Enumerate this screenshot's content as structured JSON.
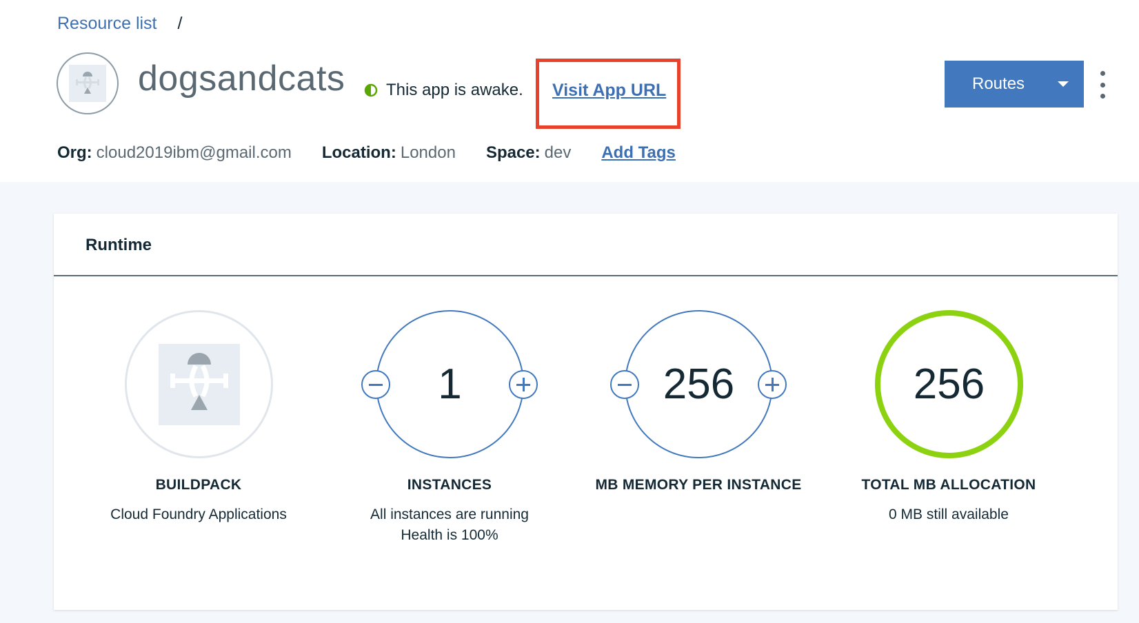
{
  "breadcrumb": {
    "resource_list": "Resource list",
    "separator": "/"
  },
  "app": {
    "name": "dogsandcats",
    "status_text": "This app is awake.",
    "visit_link": "Visit App URL"
  },
  "toolbar": {
    "routes_label": "Routes"
  },
  "meta": {
    "org_label": "Org:",
    "org_value": "cloud2019ibm@gmail.com",
    "location_label": "Location:",
    "location_value": "London",
    "space_label": "Space:",
    "space_value": "dev",
    "add_tags": "Add Tags"
  },
  "runtime": {
    "title": "Runtime",
    "buildpack": {
      "title": "BUILDPACK",
      "sub": "Cloud Foundry Applications"
    },
    "instances": {
      "value": "1",
      "title": "INSTANCES",
      "sub1": "All instances are running",
      "sub2": "Health is 100%"
    },
    "memory": {
      "value": "256",
      "title": "MB MEMORY PER INSTANCE"
    },
    "total": {
      "value": "256",
      "title": "TOTAL MB ALLOCATION",
      "sub": "0 MB still available"
    }
  },
  "colors": {
    "accent": "#4178be",
    "link": "#3d70b2",
    "status_green": "#5aa700",
    "allocation_ring": "#8cd211",
    "highlight_box": "#e8412c"
  },
  "icons": {
    "status": "half-circle-status-icon",
    "app": "cloud-foundry-app-icon",
    "routes_dropdown": "caret-down-icon",
    "overflow": "overflow-menu-icon",
    "minus": "minus-circle-icon",
    "plus": "plus-circle-icon"
  }
}
